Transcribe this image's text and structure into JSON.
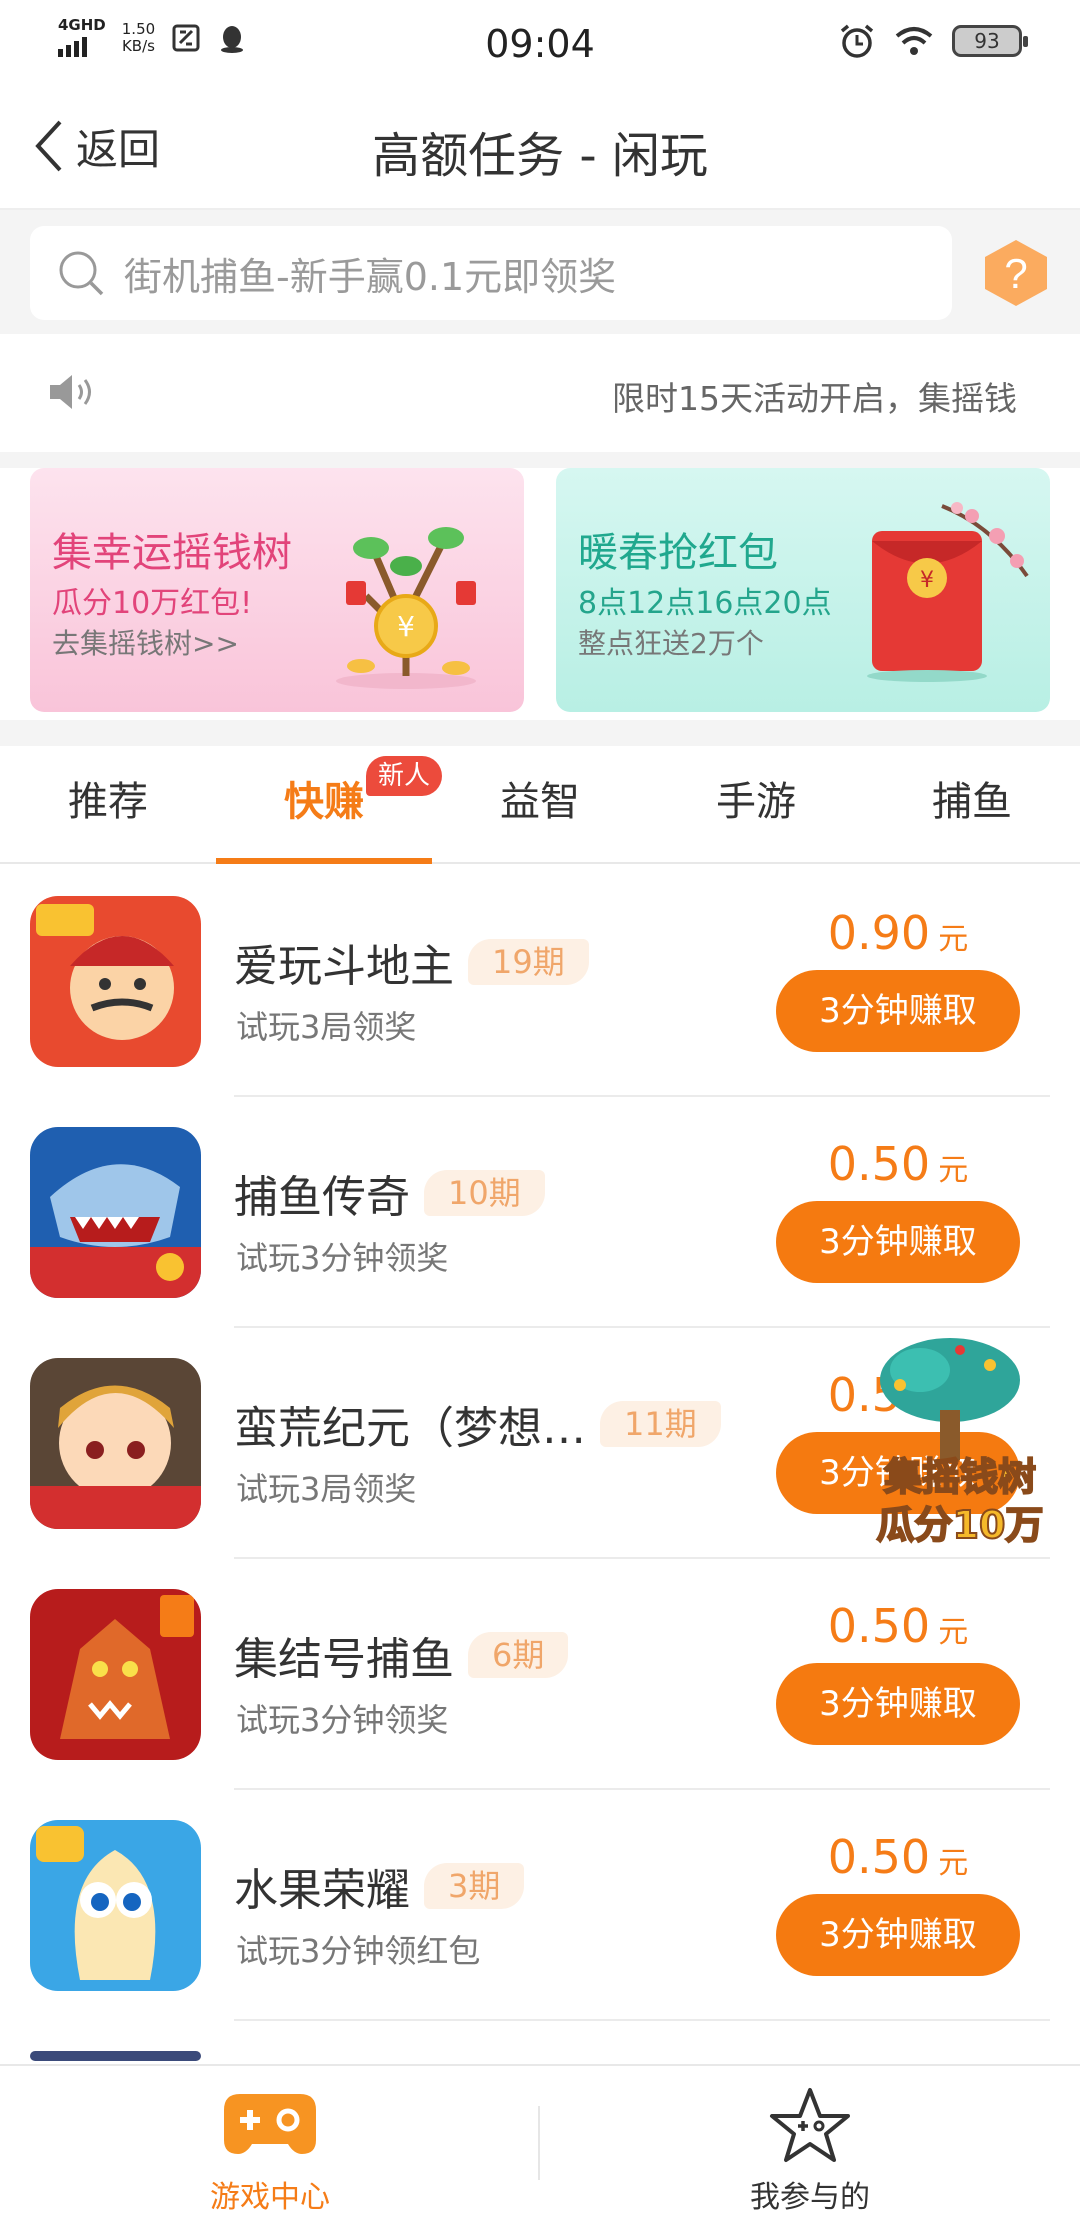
{
  "status_bar": {
    "network": "4GHD",
    "speed_value": "1.50",
    "speed_unit": "KB/s",
    "time": "09:04",
    "battery": "93"
  },
  "header": {
    "back_label": "返回",
    "title": "高额任务 - 闲玩"
  },
  "search": {
    "placeholder": "街机捕鱼-新手赢0.1元即领奖"
  },
  "notice": {
    "text": "限时15天活动开启，集摇钱"
  },
  "banners": [
    {
      "title": "集幸运摇钱树",
      "subtitle": "瓜分10万红包!",
      "link": "去集摇钱树>>"
    },
    {
      "title": "暖春抢红包",
      "subtitle": "8点12点16点20点",
      "link": "整点狂送2万个"
    }
  ],
  "tabs": [
    {
      "label": "推荐"
    },
    {
      "label": "快赚",
      "badge": "新人",
      "active": true
    },
    {
      "label": "益智"
    },
    {
      "label": "手游"
    },
    {
      "label": "捕鱼"
    }
  ],
  "games": [
    {
      "name": "爱玩斗地主",
      "period": "19期",
      "desc": "试玩3局领奖",
      "amount": "0.90",
      "unit": "元",
      "button": "3分钟赚取"
    },
    {
      "name": "捕鱼传奇",
      "period": "10期",
      "desc": "试玩3分钟领奖",
      "amount": "0.50",
      "unit": "元",
      "button": "3分钟赚取"
    },
    {
      "name": "蛮荒纪元（梦想…",
      "period": "11期",
      "desc": "试玩3局领奖",
      "amount": "0.50",
      "unit": "元",
      "button": "3分钟赚取"
    },
    {
      "name": "集结号捕鱼",
      "period": "6期",
      "desc": "试玩3分钟领奖",
      "amount": "0.50",
      "unit": "元",
      "button": "3分钟赚取"
    },
    {
      "name": "水果荣耀",
      "period": "3期",
      "desc": "试玩3分钟领红包",
      "amount": "0.50",
      "unit": "元",
      "button": "3分钟赚取"
    }
  ],
  "floating_badge": {
    "line1": "集摇钱树",
    "line2": "瓜分10万"
  },
  "bottom_nav": [
    {
      "label": "游戏中心",
      "active": true
    },
    {
      "label": "我参与的"
    }
  ],
  "colors": {
    "accent": "#f57c17",
    "badge_red": "#ec4b3c"
  }
}
